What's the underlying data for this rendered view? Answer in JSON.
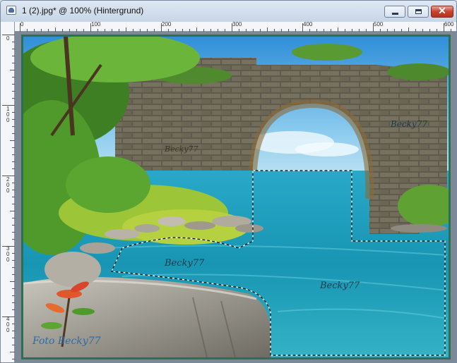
{
  "window": {
    "title": "1 (2).jpg* @ 100% (Hintergrund)",
    "close_glyph": "✕"
  },
  "ruler": {
    "top_labels": [
      "0",
      "100",
      "200",
      "300",
      "400",
      "500",
      "600"
    ],
    "left_labels": [
      "0",
      "100",
      "200",
      "300",
      "400"
    ]
  },
  "image": {
    "watermarks": [
      "Becky77",
      "Becky77",
      "Becky77",
      "Becky77"
    ],
    "corner_credit": "Foto Becky77"
  },
  "colors": {
    "canvas_border": "#2e6e55",
    "workspace": "#7d8a96",
    "close_button": "#c8412f"
  },
  "icons": [
    "photo-file-icon",
    "minimize-icon",
    "maximize-icon",
    "close-icon"
  ]
}
